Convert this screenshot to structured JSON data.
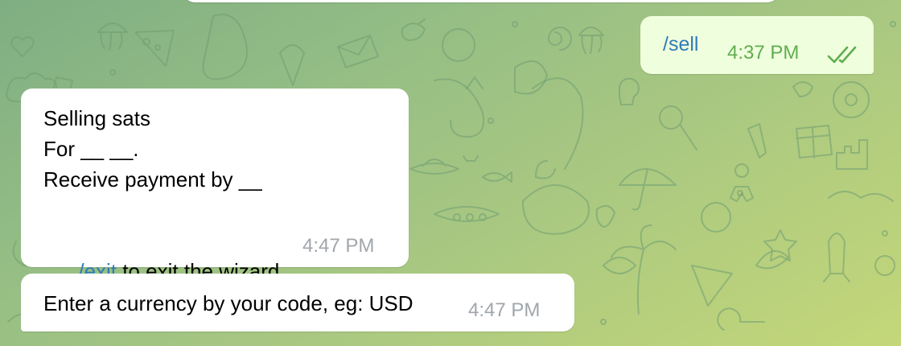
{
  "messages": {
    "outgoing_sell": {
      "command": "/sell",
      "time": "4:37 PM",
      "status_icon": "double-check-icon"
    },
    "wizard": {
      "line1": "Selling sats",
      "line2": "For __ __.",
      "line3": "Receive payment by __",
      "exit_command": "/exit",
      "exit_text": " to exit the wizard.",
      "time": "4:47 PM"
    },
    "currency_prompt": {
      "text": "Enter a currency by your code, eg: USD",
      "time": "4:47 PM"
    }
  },
  "colors": {
    "link": "#2f7cb8",
    "outgoing_bubble": "#effedd",
    "incoming_bubble": "#ffffff",
    "read_check": "#5fae4f",
    "time_gray": "#a0a6ab"
  }
}
